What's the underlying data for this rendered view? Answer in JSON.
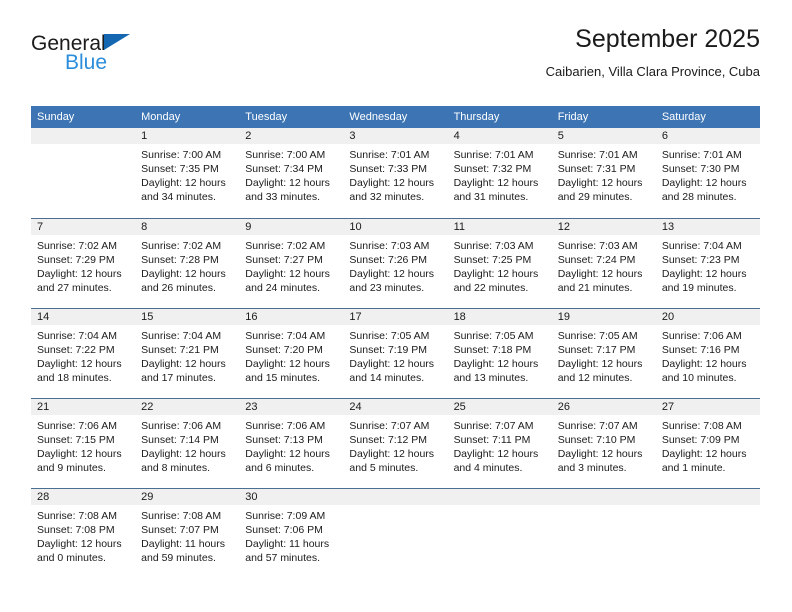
{
  "brand": {
    "name_part1": "General",
    "name_part2": "Blue",
    "triangle_color": "#1567b2",
    "blue_color": "#2b8ddb"
  },
  "header": {
    "title": "September 2025",
    "subtitle": "Caibarien, Villa Clara Province, Cuba"
  },
  "theme": {
    "header_blue": "#3c74b4",
    "daynum_band": "#f0f0f0",
    "row_rule": "#4a6f92",
    "text": "#1b1b1b"
  },
  "weekdays": [
    "Sunday",
    "Monday",
    "Tuesday",
    "Wednesday",
    "Thursday",
    "Friday",
    "Saturday"
  ],
  "weeks": [
    [
      {
        "day": "",
        "sunrise": "",
        "sunset": "",
        "daylight1": "",
        "daylight2": ""
      },
      {
        "day": "1",
        "sunrise": "Sunrise: 7:00 AM",
        "sunset": "Sunset: 7:35 PM",
        "daylight1": "Daylight: 12 hours",
        "daylight2": "and 34 minutes."
      },
      {
        "day": "2",
        "sunrise": "Sunrise: 7:00 AM",
        "sunset": "Sunset: 7:34 PM",
        "daylight1": "Daylight: 12 hours",
        "daylight2": "and 33 minutes."
      },
      {
        "day": "3",
        "sunrise": "Sunrise: 7:01 AM",
        "sunset": "Sunset: 7:33 PM",
        "daylight1": "Daylight: 12 hours",
        "daylight2": "and 32 minutes."
      },
      {
        "day": "4",
        "sunrise": "Sunrise: 7:01 AM",
        "sunset": "Sunset: 7:32 PM",
        "daylight1": "Daylight: 12 hours",
        "daylight2": "and 31 minutes."
      },
      {
        "day": "5",
        "sunrise": "Sunrise: 7:01 AM",
        "sunset": "Sunset: 7:31 PM",
        "daylight1": "Daylight: 12 hours",
        "daylight2": "and 29 minutes."
      },
      {
        "day": "6",
        "sunrise": "Sunrise: 7:01 AM",
        "sunset": "Sunset: 7:30 PM",
        "daylight1": "Daylight: 12 hours",
        "daylight2": "and 28 minutes."
      }
    ],
    [
      {
        "day": "7",
        "sunrise": "Sunrise: 7:02 AM",
        "sunset": "Sunset: 7:29 PM",
        "daylight1": "Daylight: 12 hours",
        "daylight2": "and 27 minutes."
      },
      {
        "day": "8",
        "sunrise": "Sunrise: 7:02 AM",
        "sunset": "Sunset: 7:28 PM",
        "daylight1": "Daylight: 12 hours",
        "daylight2": "and 26 minutes."
      },
      {
        "day": "9",
        "sunrise": "Sunrise: 7:02 AM",
        "sunset": "Sunset: 7:27 PM",
        "daylight1": "Daylight: 12 hours",
        "daylight2": "and 24 minutes."
      },
      {
        "day": "10",
        "sunrise": "Sunrise: 7:03 AM",
        "sunset": "Sunset: 7:26 PM",
        "daylight1": "Daylight: 12 hours",
        "daylight2": "and 23 minutes."
      },
      {
        "day": "11",
        "sunrise": "Sunrise: 7:03 AM",
        "sunset": "Sunset: 7:25 PM",
        "daylight1": "Daylight: 12 hours",
        "daylight2": "and 22 minutes."
      },
      {
        "day": "12",
        "sunrise": "Sunrise: 7:03 AM",
        "sunset": "Sunset: 7:24 PM",
        "daylight1": "Daylight: 12 hours",
        "daylight2": "and 21 minutes."
      },
      {
        "day": "13",
        "sunrise": "Sunrise: 7:04 AM",
        "sunset": "Sunset: 7:23 PM",
        "daylight1": "Daylight: 12 hours",
        "daylight2": "and 19 minutes."
      }
    ],
    [
      {
        "day": "14",
        "sunrise": "Sunrise: 7:04 AM",
        "sunset": "Sunset: 7:22 PM",
        "daylight1": "Daylight: 12 hours",
        "daylight2": "and 18 minutes."
      },
      {
        "day": "15",
        "sunrise": "Sunrise: 7:04 AM",
        "sunset": "Sunset: 7:21 PM",
        "daylight1": "Daylight: 12 hours",
        "daylight2": "and 17 minutes."
      },
      {
        "day": "16",
        "sunrise": "Sunrise: 7:04 AM",
        "sunset": "Sunset: 7:20 PM",
        "daylight1": "Daylight: 12 hours",
        "daylight2": "and 15 minutes."
      },
      {
        "day": "17",
        "sunrise": "Sunrise: 7:05 AM",
        "sunset": "Sunset: 7:19 PM",
        "daylight1": "Daylight: 12 hours",
        "daylight2": "and 14 minutes."
      },
      {
        "day": "18",
        "sunrise": "Sunrise: 7:05 AM",
        "sunset": "Sunset: 7:18 PM",
        "daylight1": "Daylight: 12 hours",
        "daylight2": "and 13 minutes."
      },
      {
        "day": "19",
        "sunrise": "Sunrise: 7:05 AM",
        "sunset": "Sunset: 7:17 PM",
        "daylight1": "Daylight: 12 hours",
        "daylight2": "and 12 minutes."
      },
      {
        "day": "20",
        "sunrise": "Sunrise: 7:06 AM",
        "sunset": "Sunset: 7:16 PM",
        "daylight1": "Daylight: 12 hours",
        "daylight2": "and 10 minutes."
      }
    ],
    [
      {
        "day": "21",
        "sunrise": "Sunrise: 7:06 AM",
        "sunset": "Sunset: 7:15 PM",
        "daylight1": "Daylight: 12 hours",
        "daylight2": "and 9 minutes."
      },
      {
        "day": "22",
        "sunrise": "Sunrise: 7:06 AM",
        "sunset": "Sunset: 7:14 PM",
        "daylight1": "Daylight: 12 hours",
        "daylight2": "and 8 minutes."
      },
      {
        "day": "23",
        "sunrise": "Sunrise: 7:06 AM",
        "sunset": "Sunset: 7:13 PM",
        "daylight1": "Daylight: 12 hours",
        "daylight2": "and 6 minutes."
      },
      {
        "day": "24",
        "sunrise": "Sunrise: 7:07 AM",
        "sunset": "Sunset: 7:12 PM",
        "daylight1": "Daylight: 12 hours",
        "daylight2": "and 5 minutes."
      },
      {
        "day": "25",
        "sunrise": "Sunrise: 7:07 AM",
        "sunset": "Sunset: 7:11 PM",
        "daylight1": "Daylight: 12 hours",
        "daylight2": "and 4 minutes."
      },
      {
        "day": "26",
        "sunrise": "Sunrise: 7:07 AM",
        "sunset": "Sunset: 7:10 PM",
        "daylight1": "Daylight: 12 hours",
        "daylight2": "and 3 minutes."
      },
      {
        "day": "27",
        "sunrise": "Sunrise: 7:08 AM",
        "sunset": "Sunset: 7:09 PM",
        "daylight1": "Daylight: 12 hours",
        "daylight2": "and 1 minute."
      }
    ],
    [
      {
        "day": "28",
        "sunrise": "Sunrise: 7:08 AM",
        "sunset": "Sunset: 7:08 PM",
        "daylight1": "Daylight: 12 hours",
        "daylight2": "and 0 minutes."
      },
      {
        "day": "29",
        "sunrise": "Sunrise: 7:08 AM",
        "sunset": "Sunset: 7:07 PM",
        "daylight1": "Daylight: 11 hours",
        "daylight2": "and 59 minutes."
      },
      {
        "day": "30",
        "sunrise": "Sunrise: 7:09 AM",
        "sunset": "Sunset: 7:06 PM",
        "daylight1": "Daylight: 11 hours",
        "daylight2": "and 57 minutes."
      },
      {
        "day": "",
        "sunrise": "",
        "sunset": "",
        "daylight1": "",
        "daylight2": ""
      },
      {
        "day": "",
        "sunrise": "",
        "sunset": "",
        "daylight1": "",
        "daylight2": ""
      },
      {
        "day": "",
        "sunrise": "",
        "sunset": "",
        "daylight1": "",
        "daylight2": ""
      },
      {
        "day": "",
        "sunrise": "",
        "sunset": "",
        "daylight1": "",
        "daylight2": ""
      }
    ]
  ]
}
